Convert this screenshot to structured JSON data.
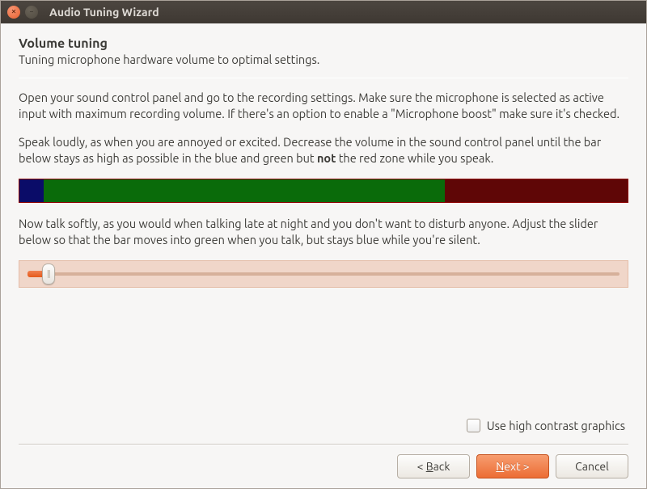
{
  "window": {
    "title": "Audio Tuning Wizard"
  },
  "page": {
    "heading": "Volume tuning",
    "subheading": "Tuning microphone hardware volume to optimal settings.",
    "para1": "Open your sound control panel and go to the recording settings. Make sure the microphone is selected as active input with maximum recording volume. If there's an option to enable a \"Microphone boost\" make sure it's checked.",
    "para2_pre": "Speak loudly, as when you are annoyed or excited. Decrease the volume in the sound control panel until the bar below stays as high as possible in the blue and green but ",
    "para2_bold": "not",
    "para2_post": " the red zone while you speak.",
    "para3": "Now talk softly, as you would when talking late at night and you don't want to disturb anyone. Adjust the slider below so that the bar moves into green when you talk, but stays blue while you're silent."
  },
  "volume_bar": {
    "blue_pct": 4,
    "green_pct": 66,
    "red_pct": 30
  },
  "slider": {
    "value": 4,
    "min": 0,
    "max": 100
  },
  "high_contrast": {
    "label": "Use high contrast graphics",
    "checked": false
  },
  "buttons": {
    "back": {
      "label": "< Back",
      "mnemonic": "B"
    },
    "next": {
      "label": "Next >",
      "mnemonic": "N"
    },
    "cancel": {
      "label": "Cancel"
    }
  }
}
